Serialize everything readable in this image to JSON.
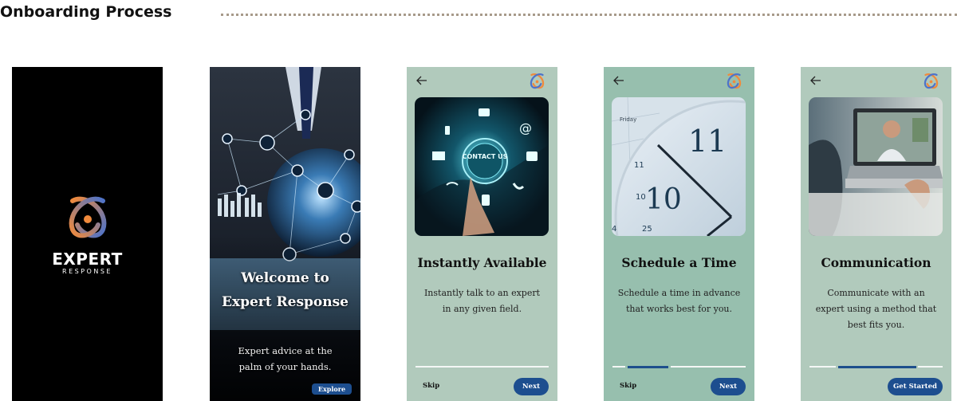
{
  "section_title": "Onboarding Process",
  "colors": {
    "accent": "#1D4E8F",
    "screen_bg": "#B1CABC",
    "screen_bg_alt": "#97BFAE",
    "logo_orange": "#F08A3C",
    "logo_blue": "#4E73C9"
  },
  "splash": {
    "logo_icon": "expert-response-logo-icon",
    "brand": "EXPERT",
    "brand_sub": "RESPONSE"
  },
  "welcome": {
    "title": "Welcome to Expert Response",
    "tagline": "Expert advice at the palm of your hands.",
    "button": "Explore"
  },
  "screens": [
    {
      "title": "Instantly Available",
      "description": "Instantly talk to an expert in any given field.",
      "photo_label": "CONTACT US",
      "skip": "Skip",
      "button": "Next",
      "progress": 1
    },
    {
      "title": "Schedule a Time",
      "description": "Schedule a time in advance that works best for you.",
      "photo_label": "Friday",
      "skip": "Skip",
      "button": "Next",
      "progress": 2
    },
    {
      "title": "Communication",
      "description": "Communicate with an expert using a method that best fits you.",
      "button": "Get Started",
      "progress": 3
    }
  ]
}
